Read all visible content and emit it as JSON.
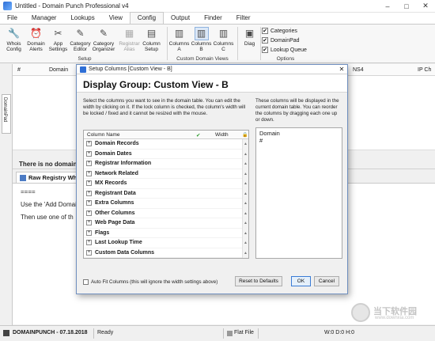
{
  "window": {
    "title": "Untitled - Domain Punch Professional v4",
    "controls": [
      "–",
      "□",
      "✕"
    ]
  },
  "menu": {
    "tabs": [
      "File",
      "Manager",
      "Lookups",
      "View",
      "Config",
      "Output",
      "Finder",
      "Filter"
    ],
    "active": "Config"
  },
  "ribbon": {
    "setup_group": {
      "label": "Setup",
      "buttons": [
        {
          "label": "Whois Config",
          "icon": "wrench-icon"
        },
        {
          "label": "Domain Alerts",
          "icon": "alert-icon"
        },
        {
          "label": "App Settings",
          "icon": "tools-icon"
        },
        {
          "label": "Category Editor",
          "icon": "folder-edit-icon"
        },
        {
          "label": "Category Organizer",
          "icon": "folder-organize-icon"
        },
        {
          "label": "Registrar Alias",
          "icon": "registrar-icon"
        },
        {
          "label": "Column Setup",
          "icon": "column-setup-icon"
        }
      ]
    },
    "custom_views_group": {
      "label": "Custom Domain Views",
      "buttons": [
        {
          "label": "Columns A",
          "icon": "columns-icon"
        },
        {
          "label": "Columns B",
          "icon": "columns-icon"
        },
        {
          "label": "Columns C",
          "icon": "columns-icon"
        }
      ]
    },
    "diag": {
      "label": "Diag",
      "icon": "diagnostics-icon"
    },
    "options_group": {
      "label": "Options",
      "items": [
        {
          "label": "Categories",
          "checked": true
        },
        {
          "label": "DomainPad",
          "checked": true
        },
        {
          "label": "Lookup Queue",
          "checked": true
        }
      ]
    }
  },
  "left_tab": "DomainPad",
  "table": {
    "headers": [
      "#",
      "Domain",
      "NS4",
      "IP Ch"
    ]
  },
  "status_message": "There is no domain",
  "registry_tab": "Raw Registry Whi",
  "registry_lines": [
    "====",
    "Use the 'Add Domai",
    "Then use one of th"
  ],
  "statusbar": {
    "brand": "DOMAINPUNCH - 07.18.2018",
    "state": "Ready",
    "file_mode": "Flat File",
    "counters": "W:0 D:0 H:0"
  },
  "dialog": {
    "title": "Setup Columns [Custom View - B]",
    "heading": "Display Group: Custom View - B",
    "desc_left": "Select the columns you want to see in the domain table. You can edit the width by clicking on it. If the lock column is checked, the column's width will be locked / fixed and it cannot be resized with the mouse.",
    "desc_right": "These columns will be displayed in the current domain table. You can reorder the columns by dragging each one up or down.",
    "list_headers": {
      "name": "Column Name",
      "check": "✔",
      "width": "Width",
      "lock": "🔒"
    },
    "groups": [
      "Domain Records",
      "Domain Dates",
      "Registrar Information",
      "Network Related",
      "MX Records",
      "Registrant Data",
      "Extra Columns",
      "Other Columns",
      "Web Page Data",
      "Flags",
      "Last Lookup Time",
      "Custom Data Columns"
    ],
    "selected_columns": [
      "Domain",
      "#"
    ],
    "autofit_label": "Auto Fit Columns (this will ignore the width settings above)",
    "reset_label": "Reset to Defaults",
    "ok_label": "OK",
    "cancel_label": "Cancel"
  },
  "watermark": {
    "text1": "当下软件园",
    "text2": "www.downxia.com"
  }
}
